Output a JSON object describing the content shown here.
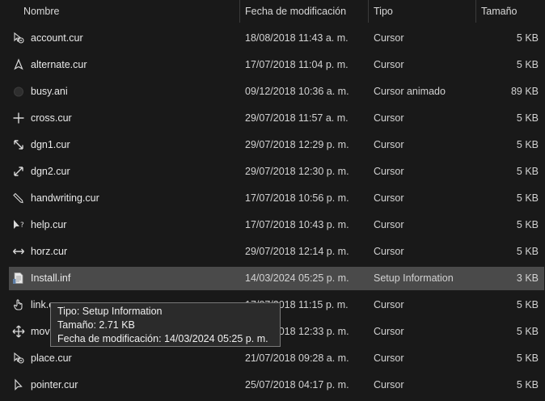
{
  "columns": {
    "name": "Nombre",
    "modified": "Fecha de modificación",
    "type": "Tipo",
    "size": "Tamaño"
  },
  "files": [
    {
      "name": "account.cur",
      "modified": "18/08/2018 11:43 a. m.",
      "type": "Cursor",
      "size": "5 KB",
      "icon": "cursor-pin-icon"
    },
    {
      "name": "alternate.cur",
      "modified": "17/07/2018 11:04 p. m.",
      "type": "Cursor",
      "size": "5 KB",
      "icon": "cursor-alternate-icon"
    },
    {
      "name": "busy.ani",
      "modified": "09/12/2018 10:36 a. m.",
      "type": "Cursor animado",
      "size": "89 KB",
      "icon": "cursor-busy-icon"
    },
    {
      "name": "cross.cur",
      "modified": "29/07/2018 11:57 a. m.",
      "type": "Cursor",
      "size": "5 KB",
      "icon": "cursor-cross-icon"
    },
    {
      "name": "dgn1.cur",
      "modified": "29/07/2018 12:29 p. m.",
      "type": "Cursor",
      "size": "5 KB",
      "icon": "cursor-diagonal1-icon"
    },
    {
      "name": "dgn2.cur",
      "modified": "29/07/2018 12:30 p. m.",
      "type": "Cursor",
      "size": "5 KB",
      "icon": "cursor-diagonal2-icon"
    },
    {
      "name": "handwriting.cur",
      "modified": "17/07/2018 10:56 p. m.",
      "type": "Cursor",
      "size": "5 KB",
      "icon": "cursor-pen-icon"
    },
    {
      "name": "help.cur",
      "modified": "17/07/2018 10:43 p. m.",
      "type": "Cursor",
      "size": "5 KB",
      "icon": "cursor-help-icon"
    },
    {
      "name": "horz.cur",
      "modified": "29/07/2018 12:14 p. m.",
      "type": "Cursor",
      "size": "5 KB",
      "icon": "cursor-horizontal-icon"
    },
    {
      "name": "Install.inf",
      "modified": "14/03/2024 05:25 p. m.",
      "type": "Setup Information",
      "size": "3 KB",
      "icon": "setup-file-icon",
      "selected": true
    },
    {
      "name": "link.cur",
      "modified": "17/07/2018 11:15 p. m.",
      "type": "Cursor",
      "size": "5 KB",
      "icon": "cursor-hand-icon"
    },
    {
      "name": "move.cur",
      "modified": "29/07/2018 12:33 p. m.",
      "type": "Cursor",
      "size": "5 KB",
      "icon": "cursor-move-icon"
    },
    {
      "name": "place.cur",
      "modified": "21/07/2018 09:28 a. m.",
      "type": "Cursor",
      "size": "5 KB",
      "icon": "cursor-pin-icon"
    },
    {
      "name": "pointer.cur",
      "modified": "25/07/2018 04:17 p. m.",
      "type": "Cursor",
      "size": "5 KB",
      "icon": "cursor-arrow-icon"
    }
  ],
  "tooltip": {
    "line1": "Tipo: Setup Information",
    "line2": "Tamaño: 2.71 KB",
    "line3": "Fecha de modificación: 14/03/2024 05:25 p. m."
  },
  "colors": {
    "background": "#191919",
    "selected_row": "#4a4a4a",
    "text": "#e6e6e6"
  }
}
